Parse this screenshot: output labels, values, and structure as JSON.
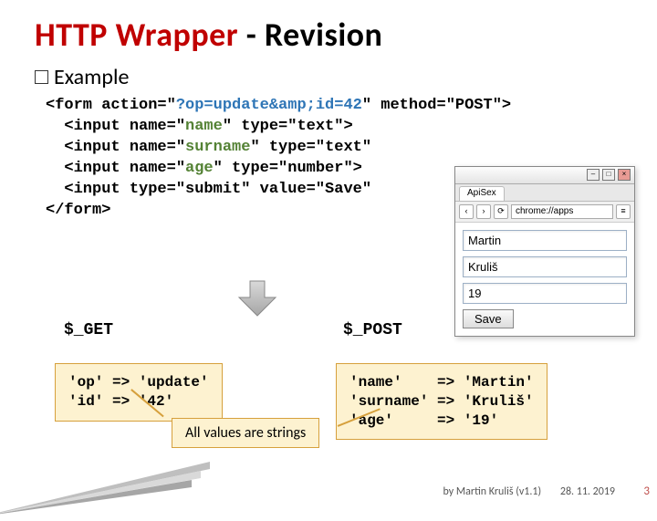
{
  "title": {
    "red": "HTTP Wrapper",
    "dash": " - ",
    "black": "Revision"
  },
  "exampleLabel": "Example",
  "code": {
    "l1a": "<form action=\"",
    "l1b": "?op=update&amp;id=42",
    "l1c": "\" method=\"POST\">",
    "l2a": "  <input name=\"",
    "l2b": "name",
    "l2c": "\" type=\"text\">",
    "l3a": "  <input name=\"",
    "l3b": "surname",
    "l3c": "\" type=\"text\"",
    "l4a": "  <input name=\"",
    "l4b": "age",
    "l4c": "\" type=\"number\">",
    "l5": "  <input type=\"submit\" value=\"Save\"",
    "l6": "</form>"
  },
  "getLabel": "$_GET",
  "postLabel": "$_POST",
  "getBox": "'op' => 'update'\n'id' => '42'",
  "postBox": "'name'    => 'Martin'\n'surname' => 'Kruliš'\n'age'     => '19'",
  "callout": "All values are strings",
  "browser": {
    "tab": "ApiSex",
    "url": "chrome://apps",
    "fields": {
      "name": "Martin",
      "surname": "Kruliš",
      "age": "19"
    },
    "save": "Save"
  },
  "footer": {
    "author": "by Martin Kruliš (v1.1)",
    "date": "28. 11. 2019"
  },
  "page": "3"
}
